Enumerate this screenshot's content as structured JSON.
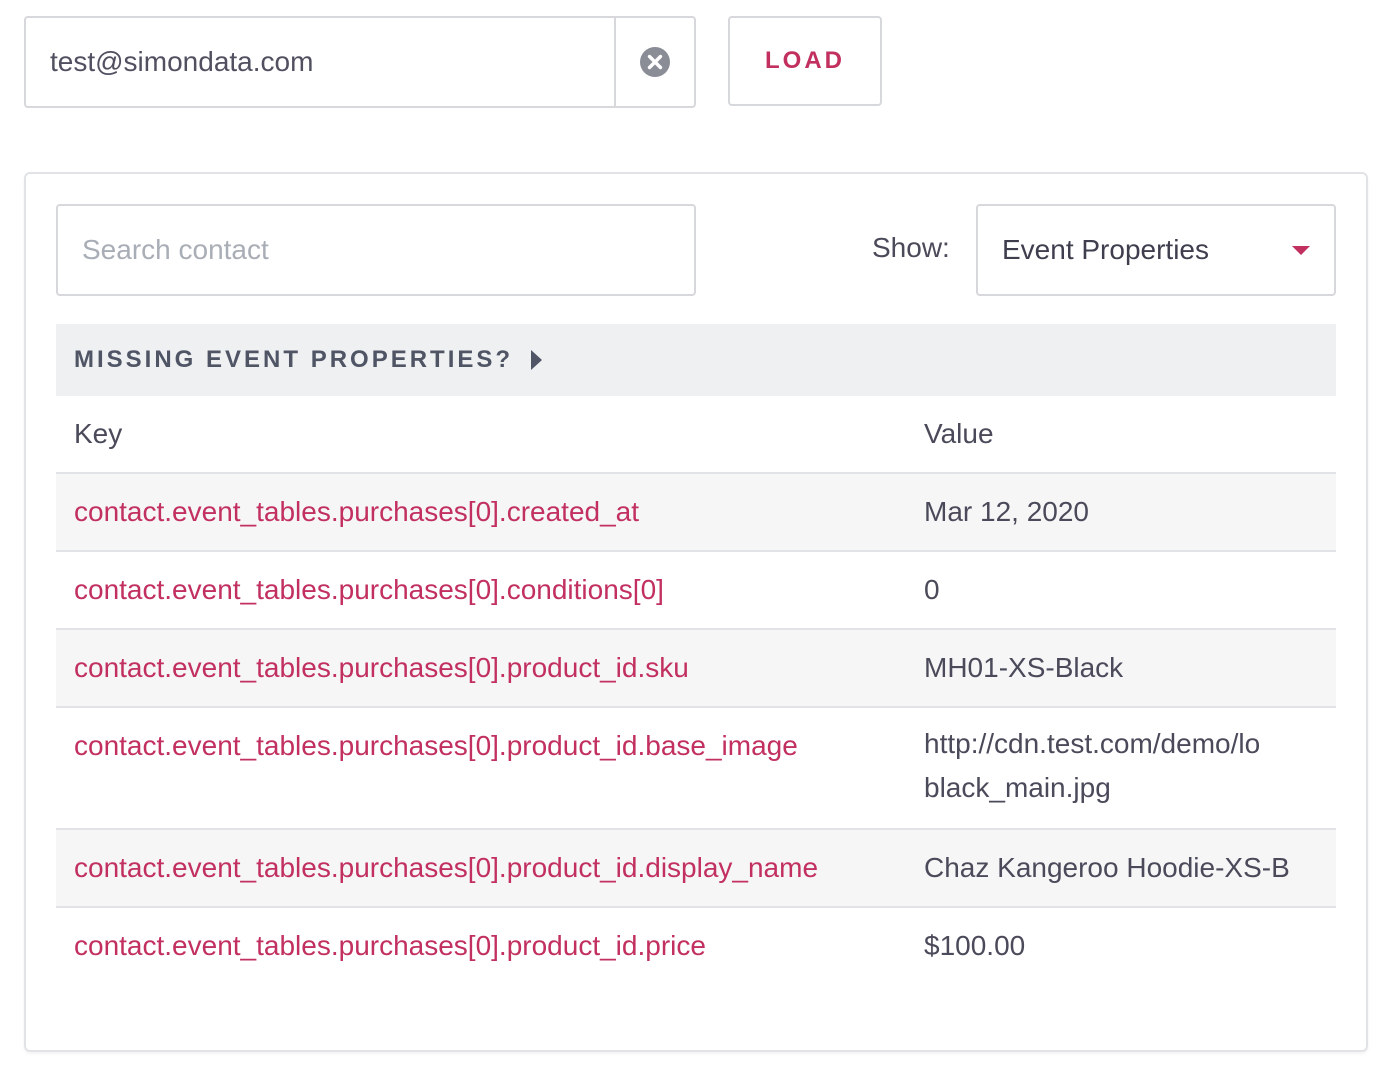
{
  "email": {
    "value": "test@simondata.com"
  },
  "load_button": {
    "label": "LOAD"
  },
  "search": {
    "placeholder": "Search contact"
  },
  "show": {
    "label": "Show:",
    "selected": "Event Properties"
  },
  "missing_bar": {
    "text": "MISSING EVENT PROPERTIES?"
  },
  "table": {
    "headers": {
      "key": "Key",
      "value": "Value"
    },
    "rows": [
      {
        "key": "contact.event_tables.purchases[0].created_at",
        "value": "Mar 12, 2020"
      },
      {
        "key": "contact.event_tables.purchases[0].conditions[0]",
        "value": "0"
      },
      {
        "key": "contact.event_tables.purchases[0].product_id.sku",
        "value": "MH01-XS-Black"
      },
      {
        "key": "contact.event_tables.purchases[0].product_id.base_image",
        "value": "http://cdn.test.com/demo/lo",
        "value_line2": "black_main.jpg"
      },
      {
        "key": "contact.event_tables.purchases[0].product_id.display_name",
        "value": "Chaz Kangeroo Hoodie-XS-B"
      },
      {
        "key": "contact.event_tables.purchases[0].product_id.price",
        "value": "$100.00"
      }
    ]
  },
  "colors": {
    "accent": "#c2305f",
    "border": "#d6d8dc",
    "bar_bg": "#eff0f2",
    "text": "#4a4a5a"
  },
  "icons": {
    "clear": "close-circle-icon",
    "dropdown": "caret-down-icon",
    "expand": "play-right-icon"
  }
}
